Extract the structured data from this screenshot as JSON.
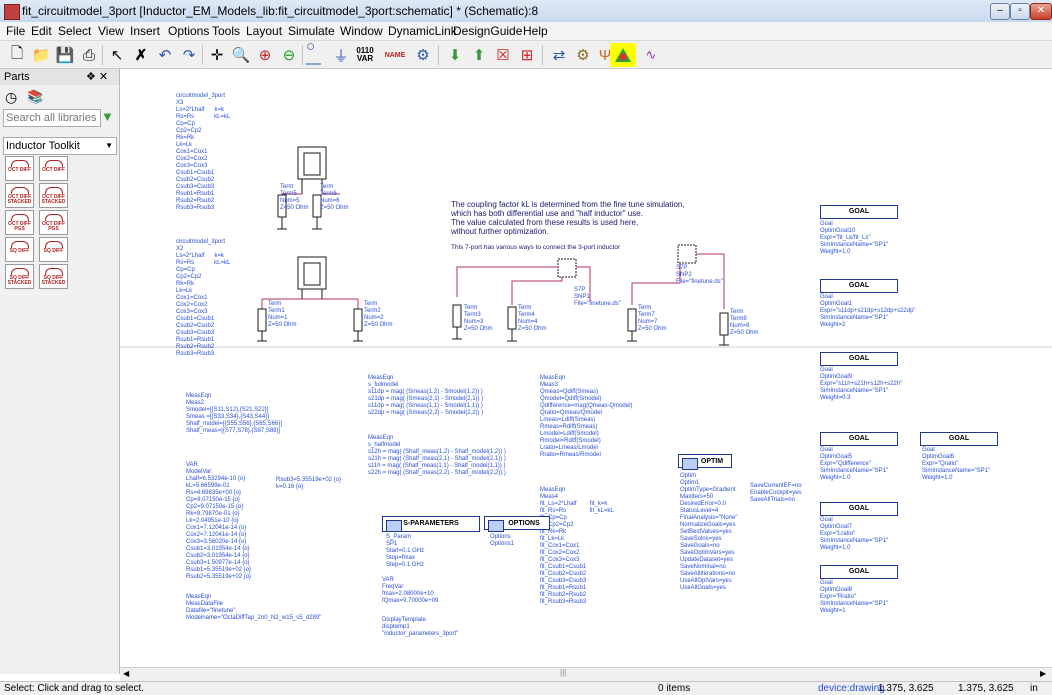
{
  "window": {
    "title": "fit_circuitmodel_3port [Inductor_EM_Models_lib:fit_circuitmodel_3port:schematic] * (Schematic):8",
    "buttons": [
      "–",
      "▫",
      "✕"
    ]
  },
  "menu": [
    "File",
    "Edit",
    "Select",
    "View",
    "Insert",
    "Options",
    "Tools",
    "Layout",
    "Simulate",
    "Window",
    "DynamicLink",
    "DesignGuide",
    "Help"
  ],
  "toolbar": {
    "var_label": "VAR",
    "name_label": "NAME",
    "bits_label": "0110"
  },
  "parts_panel": {
    "title": "Parts",
    "pin": "❖ ✕",
    "search_placeholder": "Search all libraries",
    "library": "Inductor Toolkit",
    "items": [
      {
        "label": "OCT DIFF"
      },
      {
        "label": "OCT DIFF"
      },
      {
        "label": "OCT DIFF STACKED"
      },
      {
        "label": "OCT DIFF STACKED"
      },
      {
        "label": "OCT DIFF PGS"
      },
      {
        "label": "OCT DIFF PGS"
      },
      {
        "label": "SQ DIFF"
      },
      {
        "label": "SQ DIFF"
      },
      {
        "label": "SQ DIFF STACKED"
      },
      {
        "label": "SQ DIFF STACKED"
      }
    ]
  },
  "schematic": {
    "x3_block": "circuitmodel_3port\nX3\nLs=2*Lhalf      k=k\nRs=Rs            kL=kL\nCp=Cp\nCp2=Cp2\nRk=Rk\nLk=Lk\nCox1=Cox1\nCox2=Cox2\nCox3=Cox3\nCsub1=Csub1\nCsub2=Csub2\nCsub3=Csub3\nRsub1=Rsub1\nRsub2=Rsub2\nRsub3=Rsub3",
    "x2_block": "circuitmodel_3port\nX2\nLs=2*Lhalf      k=k\nRs=Rs            kL=kL\nCp=Cp\nCp2=Cp2\nRk=Rk\nLk=Lk\nCox1=Cox1\nCox2=Cox2\nCox3=Cox3\nCsub1=Csub1\nCsub2=Csub2\nCsub3=Csub3\nRsub1=Rsub1\nRsub2=Rsub2\nRsub3=Rsub3",
    "note1": "The coupling factor kL is determined from the fine tune simulation,\nwhich has both differential use and \"half inductor\" use.\nThe value calculated from these results is used here,\nwithout further optimization.",
    "note2": "This 7-port has various ways to connect the 3-port inductor",
    "term5": "Term\nTerm5\nNum=5\nZ=50 Ohm",
    "term6": "Term\nTerm6\nNum=6\nZ=50 Ohm",
    "term1": "Term\nTerm1\nNum=1\nZ=50 Ohm",
    "term2": "Term\nTerm2\nNum=2\nZ=50 Ohm",
    "term3": "Term\nTerm3\nNum=3\nZ=50 Ohm",
    "term4": "Term\nTerm4\nNum=4\nZ=50 Ohm",
    "term7": "Term\nTerm7\nNum=7\nZ=50 Ohm",
    "term8": "Term\nTerm8\nNum=8\nZ=50 Ohm",
    "snp1": "S7P\nSNP1\nFile=\"finetune.ds\"",
    "snp2": "S7P\nSNP2\nFile=\"finetune.ds\"",
    "meas2": "MeasEqn\nMeas2\nSmodel=[{S11,S12},{S21,S22}]\nSmeas =[{S33,S34},{S43,S44}]\nShalf_model=[{S55,S56},{S65,S66}]\nShalf_meas=[{S77,S78},{S87,S88}]",
    "s_fullmodel": "MeasEqn\ns_fullmodel\ns11dp = mag( (Smeas(1,2) - Smodel(1,2)) )\ns21dp = mag( (Smeas(2,1) - Smodel(2,1)) )\ns11dp = mag( (Smeas(1,1) - Smodel(1,1)) )\ns22dp = mag( (Smeas(2,2) - Smodel(2,2)) )",
    "s_halfmodel": "MeasEqn\ns_halfmodel\ns12h = mag( (Shalf_meas(1,2) - Shalf_model(1,2)) )\ns21h = mag( (Shalf_meas(2,1) - Shalf_model(2,1)) )\ns11h = mag( (Shalf_meas(1,1) - Shalf_model(1,1)) )\ns22h = mag( (Shalf_meas(2,2) - Shalf_model(2,2)) )",
    "meas3": "MeasEqn\nMeas3\nQmeas=Qdiff(Smeas)\nQmodel=Qdiff(Smodel)\nQdifference=mag(Qmeas-Qmodel)\nQratio=Qmeas/Qmodel\nLmeas=Ldiff(Smeas)\nRmeas=Rdiff(Smeas)\nLmodel=Ldiff(Smodel)\nRmodel=Rdiff(Smodel)\nLratio=Lmeas/Lmodel\nRratio=Rmeas/Rmodel",
    "meas4": "MeasEqn\nMeas4\nfit_Ls=2*Lhalf        fit_k=k\nfit_Rs=Rs              fit_kL=kL\nfit_Cp=Cp\nfit_Cp2=Cp2\nfit_Rk=Rk\nfit_Lk=Lk\nfit_Cox1=Cox1\nfit_Cox2=Cox2\nfit_Cox3=Cox3\nfit_Csub1=Csub1\nfit_Csub2=Csub2\nfit_Csub3=Csub3\nfit_Rsub1=Rsub1\nfit_Rsub2=Rsub2\nfit_Rsub3=Rsub3",
    "modelvar": "VAR\nModelVar\nLhalf=6.53294e-10 {o}\nkL=5.66599e-01\nRs=4.69835e+00 {o}\nCp=9.07150e-15 {o}\nCp2=9.07150e-15 {o}\nRk=9.79870e-01 {o}\nLk=2.04951e-10 {o}\nCox1=7.12041e-14 {o}\nCox2=7.12041e-14 {o}\nCox3=3.56020e-14 {o}\nCsub1=3.01954e-14 {o}\nCsub2=3.01954e-14 {o}\nCsub3=1.50977e-14 {o}\nRsub1=5.35519e+02 {o}\nRsub2=5.35519e+02 {o}",
    "modelvar_right": "Rsub3=5.35519e+02 {o}\nk=0.16 {o}",
    "measdatafile": "MeasEqn\nMeasDataFile\nDatafile=\"finetune\"\nModelname=\"OctaDiffTap_2n0_N2_w15_s5_d289\"",
    "freqvar": "VAR\nFreqVar\nfmax=2.08000e+10\nfQmax=9.70000e+09",
    "displaytemplate": "DisplayTemplate\ndisptemp1\n\"inductor_parameters_3port\"",
    "sparam": "S_Param\nSP1\nStart=0.1 GHz\nStop=fmax\nStep=0.1 GHz",
    "options": "Options\nOptions1",
    "optim": "Optim\nOptim1\nOptimType=Gradient\nMaxIters=50\nDesiredError=0.0\nStatusLevel=4\nFinalAnalysis=\"None\"\nNormalizeGoals=yes\nSetBestValues=yes\nSaveSolns=yes\nSaveGoals=no\nSaveOptimVars=yes\nUpdateDataset=yes\nSaveNominal=no\nSaveAllIterations=no\nUseAllOptVars=yes\nUseAllGoals=yes",
    "optim_right": "SaveCurrentEF=no\nEnableCockpit=yes\nSaveAllTrials=no",
    "sparam_title": "S-PARAMETERS",
    "options_title": "OPTIONS",
    "optim_title": "OPTIM",
    "goal_title": "GOAL",
    "goal10": "Goal\nOptimGoal10\nExpr=\"fit_Lk/fit_Ls\"\nSimInstanceName=\"SP1\"\nWeight=1.0",
    "goal1": "Goal\nOptimGoal1\nExpr=\"s11dp+s21dp+s12dp+s22dp\"\nSimInstanceName=\"SP1\"\nWeight=2",
    "goal9": "Goal\nOptimGoal9\nExpr=\"s11h+s21h+s12h+s22h\"\nSimInstanceName=\"SP1\"\nWeight=0.3",
    "goal5": "Goal\nOptimGoal5\nExpr=\"Qdifference\"\nSimInstanceName=\"SP1\"\nWeight=1.0",
    "goal6": "Goal\nOptimGoal6\nExpr=\"Qratio\"\nSimInstanceName=\"SP1\"\nWeight=1.0",
    "goal7": "Goal\nOptimGoal7\nExpr=\"Lratio\"\nSimInstanceName=\"SP1\"\nWeight=1.0",
    "goal8": "Goal\nOptimGoal8\nExpr=\"Rratio\"\nSimInstanceName=\"SP1\"\nWeight=1"
  },
  "status": {
    "hint": "Select: Click and drag to select.",
    "items": "0 items",
    "context": "device:drawing",
    "coord1": "1.375, 3.625",
    "coord2": "1.375, 3.625",
    "unit": "in"
  },
  "colors": {
    "wire": "#b0306a",
    "component": "#1a1a1a",
    "text_blue": "#2b4fd8",
    "highlight": "#ffff00"
  }
}
